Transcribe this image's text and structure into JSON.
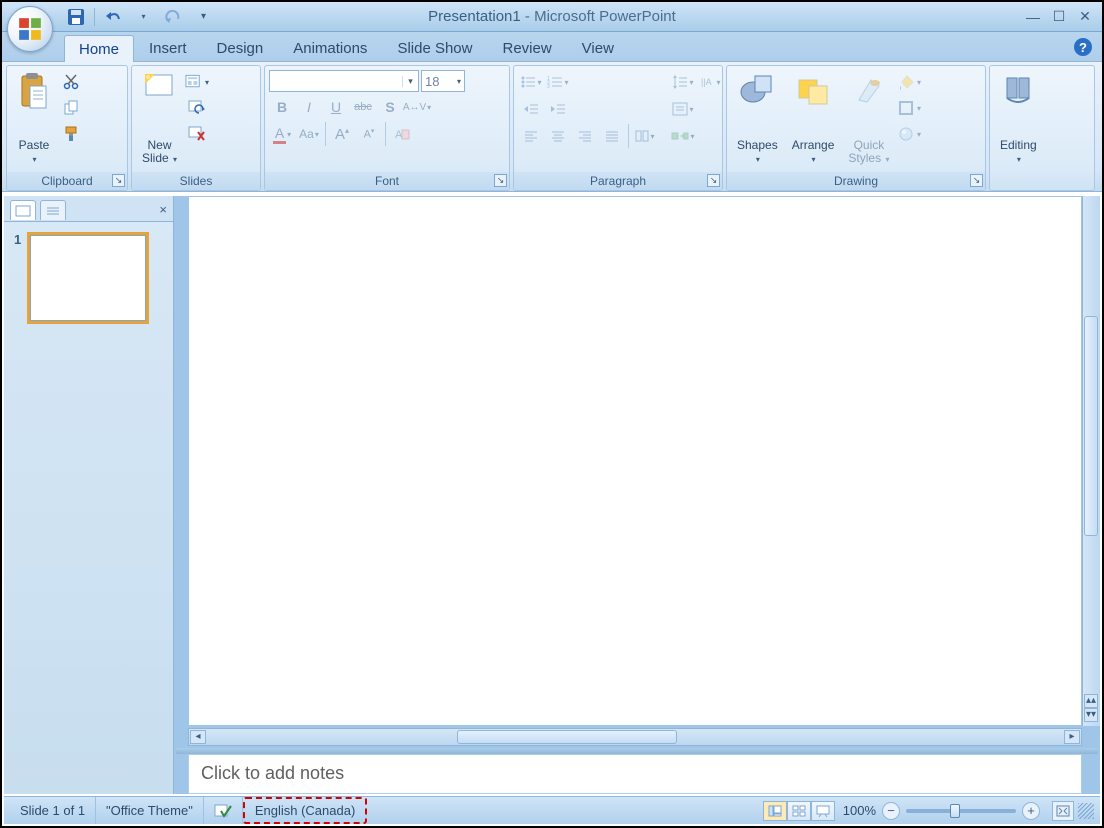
{
  "title": {
    "doc": "Presentation1",
    "separator": " - ",
    "app": "Microsoft PowerPoint"
  },
  "qat": {
    "save": "Save",
    "undo": "Undo",
    "redo": "Redo",
    "customize": "Customize"
  },
  "tabs": [
    "Home",
    "Insert",
    "Design",
    "Animations",
    "Slide Show",
    "Review",
    "View"
  ],
  "activeTab": 0,
  "ribbon": {
    "clipboard": {
      "label": "Clipboard",
      "paste": "Paste",
      "cut": "Cut",
      "copy": "Copy",
      "format_painter": "Format Painter"
    },
    "slides": {
      "label": "Slides",
      "new_slide": "New\nSlide",
      "layout": "Layout",
      "reset": "Reset",
      "delete": "Delete"
    },
    "font": {
      "label": "Font",
      "name": "",
      "size": "18",
      "bold": "B",
      "italic": "I",
      "underline": "U",
      "strike": "abc",
      "shadow": "S",
      "char_spacing": "AV",
      "color": "A",
      "change_case": "Aa",
      "grow": "A",
      "shrink": "A",
      "clear": "Clear"
    },
    "paragraph": {
      "label": "Paragraph",
      "bullets": "Bullets",
      "numbering": "Numbering",
      "indent_dec": "Decrease",
      "indent_inc": "Increase",
      "line_spacing": "Line",
      "text_dir": "Dir",
      "columns": "Cols",
      "align_l": "Left",
      "align_c": "Center",
      "align_r": "Right",
      "justify": "Justify",
      "align_text": "Align Text",
      "smartart": "SmartArt"
    },
    "drawing": {
      "label": "Drawing",
      "shapes": "Shapes",
      "arrange": "Arrange",
      "quick_styles": "Quick\nStyles",
      "fill": "Fill",
      "outline": "Outline",
      "effects": "Effects"
    },
    "editing": {
      "label": "Editing",
      "find": "Editing"
    }
  },
  "pane": {
    "tab_slides": "Slides",
    "tab_outline": "Outline",
    "close": "×",
    "thumb_number": "1"
  },
  "notes_placeholder": "Click to add notes",
  "status": {
    "slide": "Slide 1 of 1",
    "theme": "\"Office Theme\"",
    "spell": "Spell Check",
    "language": "English (Canada)",
    "zoom_pct": "100%",
    "views": {
      "normal": "Normal",
      "sorter": "Sorter",
      "show": "Show"
    }
  }
}
